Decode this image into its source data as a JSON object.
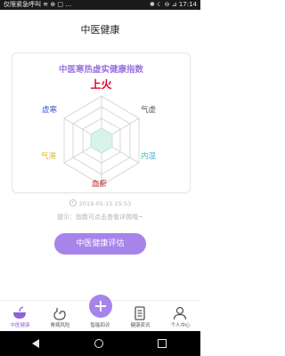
{
  "status_bar": {
    "left": "仅限紧急呼叫 ≋ ⊕ □ …",
    "right": "✱ ☾ ⊖ ⊿ 17:14"
  },
  "header": {
    "title": "中医健康"
  },
  "card": {
    "title": "中医寒热虚实健康指数",
    "result": "上火",
    "labels": [
      {
        "text": "虚寒",
        "color": "#3b55c9"
      },
      {
        "text": "气虚",
        "color": "#555555"
      },
      {
        "text": "气滞",
        "color": "#e3b32a"
      },
      {
        "text": "内湿",
        "color": "#45b4d2"
      },
      {
        "text": "血瘀",
        "color": "#b8121b"
      }
    ]
  },
  "record": {
    "date": "2019-05-15 15:53",
    "hint": "提示：指数可点击查看详情哦~"
  },
  "action": {
    "evaluate_label": "中医健康评估"
  },
  "tabs": [
    {
      "label": "中医健康",
      "icon": "bowl-icon"
    },
    {
      "label": "胃病风险",
      "icon": "stomach-icon"
    },
    {
      "label": "智能四诊",
      "icon": "plus-icon"
    },
    {
      "label": "健康资讯",
      "icon": "news-icon"
    },
    {
      "label": "个人中心",
      "icon": "person-icon"
    }
  ],
  "colors": {
    "accent": "#a684ea",
    "result": "#e0002a",
    "radar_fill": "#d8f3ea"
  }
}
